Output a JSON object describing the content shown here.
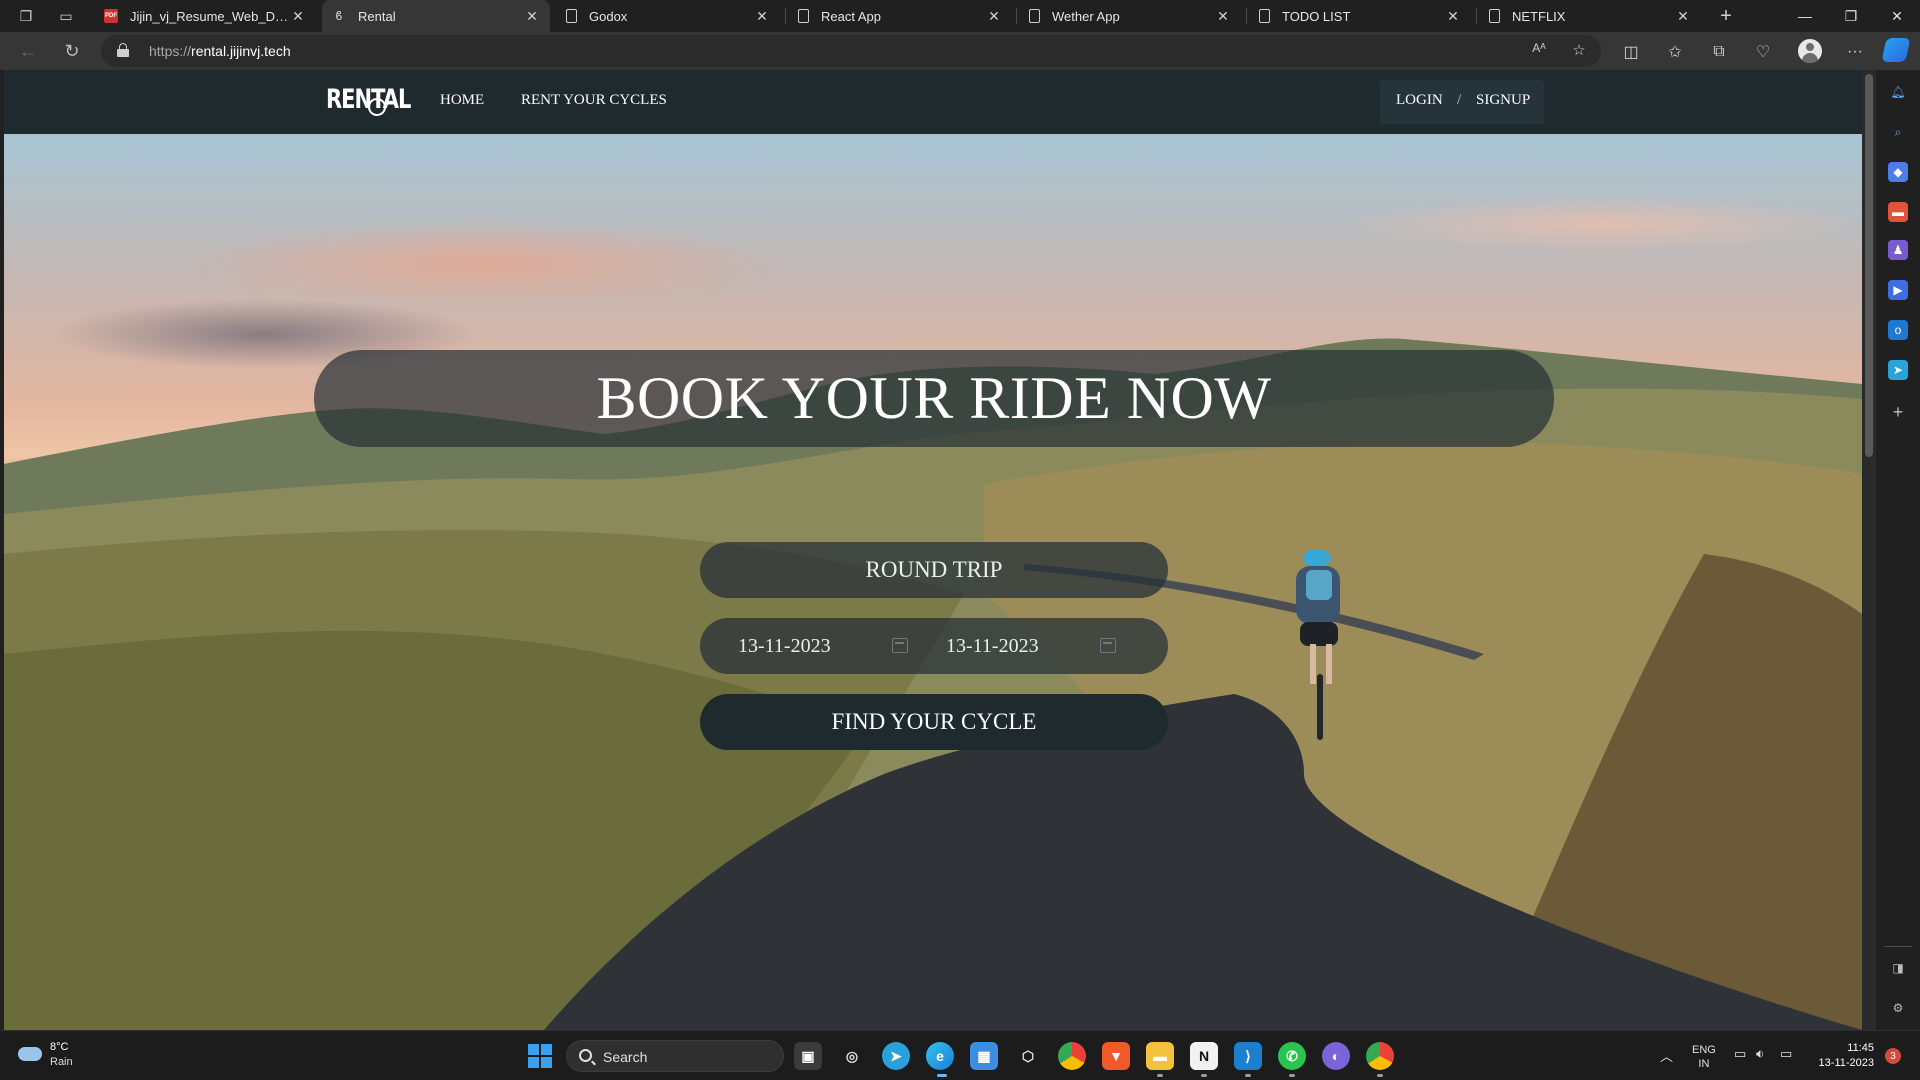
{
  "browser": {
    "tabs": [
      {
        "title": "Jijin_vj_Resume_Web_Develope",
        "icon": "pdf-icon",
        "active": false
      },
      {
        "title": "Rental",
        "icon": "bicycle-icon",
        "active": true
      },
      {
        "title": "Godox",
        "icon": "page-icon",
        "active": false
      },
      {
        "title": "React App",
        "icon": "page-icon",
        "active": false
      },
      {
        "title": "Wether App",
        "icon": "page-icon",
        "active": false
      },
      {
        "title": "TODO LIST",
        "icon": "page-icon",
        "active": false
      },
      {
        "title": "NETFLIX",
        "icon": "page-icon",
        "active": false
      }
    ],
    "address": {
      "scheme": "https://",
      "host": "rental.jijinvj.tech"
    }
  },
  "site": {
    "logo_text": "RENTAL",
    "nav": {
      "home": "HOME",
      "rent": "RENT YOUR CYCLES",
      "login": "LOGIN",
      "separator": "/",
      "signup": "SIGNUP"
    },
    "hero": {
      "headline": "BOOK YOUR RIDE NOW",
      "trip_type": "ROUND TRIP",
      "start_date": "13-11-2023",
      "end_date": "13-11-2023",
      "cta": "FIND YOUR CYCLE"
    },
    "colors": {
      "navbar": "#1e2a2e",
      "overlay": "#283238",
      "button": "#1e2a2e"
    }
  },
  "taskbar": {
    "weather": {
      "temp": "8°C",
      "condition": "Rain"
    },
    "search_label": "Search",
    "language": {
      "line1": "ENG",
      "line2": "IN"
    },
    "time": "11:45",
    "date": "13-11-2023",
    "notification_count": "3"
  }
}
